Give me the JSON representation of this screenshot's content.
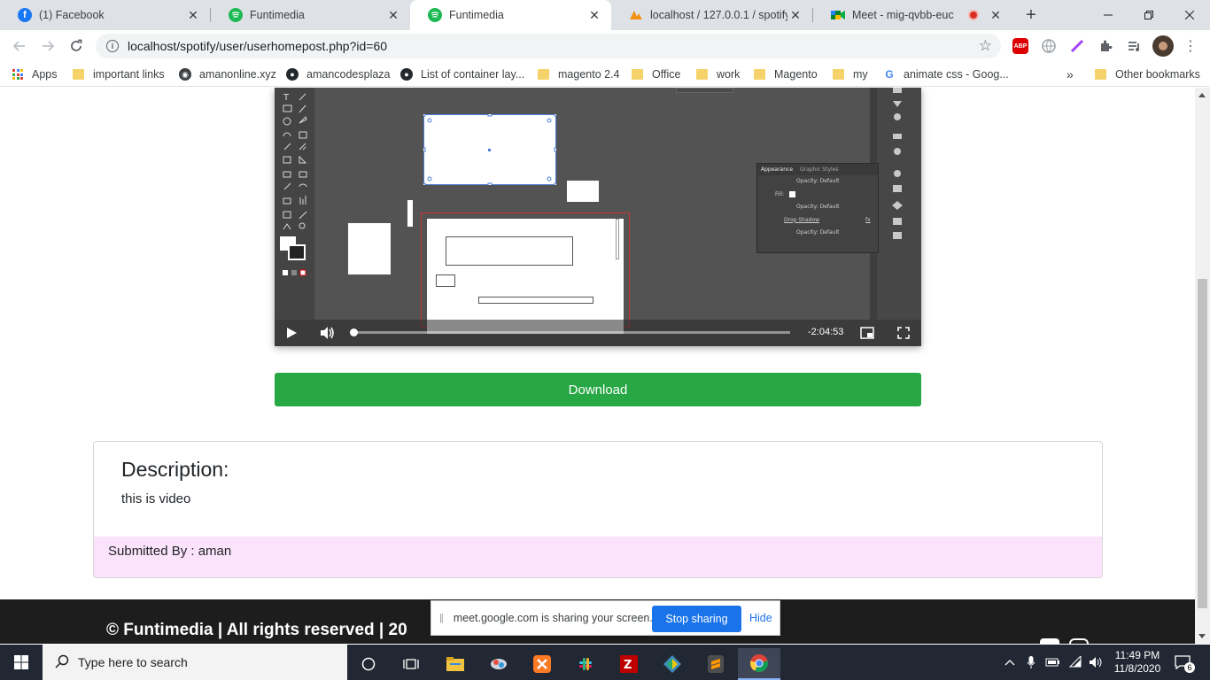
{
  "browser": {
    "tabs": [
      {
        "title": "(1) Facebook",
        "icon": "facebook-icon"
      },
      {
        "title": "Funtimedia",
        "icon": "spotify-icon"
      },
      {
        "title": "Funtimedia",
        "icon": "spotify-icon",
        "active": true
      },
      {
        "title": "localhost / 127.0.0.1 / spotify /",
        "icon": "phpmyadmin-icon"
      },
      {
        "title": "Meet - mig-qvbb-euc",
        "icon": "meet-icon"
      }
    ],
    "tab_close_glyph": "✕",
    "new_tab_glyph": "+",
    "url": "localhost/spotify/user/userhomepost.php?id=60",
    "extensions": {
      "abp": "ABP"
    }
  },
  "bookmarks": {
    "items": [
      {
        "label": "Apps",
        "kind": "apps"
      },
      {
        "label": "important links",
        "kind": "folder"
      },
      {
        "label": "amanonline.xyz",
        "kind": "site"
      },
      {
        "label": "amancodesplaza",
        "kind": "github"
      },
      {
        "label": "List of container lay...",
        "kind": "github"
      },
      {
        "label": "magento 2.4",
        "kind": "folder"
      },
      {
        "label": "Office",
        "kind": "folder"
      },
      {
        "label": "work",
        "kind": "folder"
      },
      {
        "label": "Magento",
        "kind": "folder"
      },
      {
        "label": "my",
        "kind": "folder"
      },
      {
        "label": "animate css - Goog...",
        "kind": "google"
      }
    ],
    "overflow": "»",
    "other": "Other bookmarks"
  },
  "video": {
    "time_remaining": "-2:04:53",
    "progress_fraction": 0.0,
    "editor_panel": {
      "tabs": [
        "Appearance",
        "Graphic Styles"
      ],
      "rows": [
        "Opacity: Default",
        "Fill:",
        "Opacity: Default",
        "Drop Shadow",
        "Opacity: Default"
      ],
      "fx": "fx"
    }
  },
  "download_label": "Download",
  "description": {
    "heading": "Description:",
    "text": "this is video",
    "submitted": "Submitted By : aman"
  },
  "footer": {
    "text": "© Funtimedia | All rights reserved | 20"
  },
  "sharebar": {
    "message": "meet.google.com is sharing your screen.",
    "stop": "Stop sharing",
    "hide": "Hide"
  },
  "taskbar": {
    "search_placeholder": "Type here to search",
    "time": "11:49 PM",
    "date": "11/8/2020",
    "notification_count": "6"
  },
  "colors": {
    "accent": "#28a745",
    "footer_bg": "#1d1d1d",
    "submitted_bg": "#fbe3fb",
    "chrome_blue": "#1a73e8"
  }
}
